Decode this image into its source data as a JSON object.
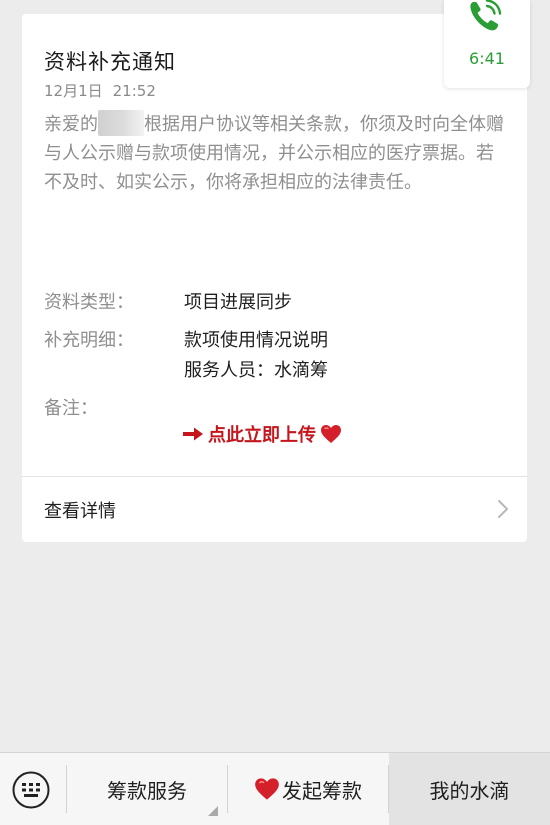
{
  "notification": {
    "title": "资料补充通知",
    "date": "12月1日",
    "time": "21:52",
    "intro_prefix": "亲爱的",
    "intro_rest": "根据用户协议等相关条款，你须及时向全体赠与人公示赠与款项使用情况，并公示相应的医疗票据。若不及时、如实公示，你将承担相应的法律责任。",
    "fields": {
      "type_label": "资料类型：",
      "type_value": "项目进展同步",
      "detail_label": "补充明细：",
      "detail_value_1": "款项使用情况说明",
      "detail_value_2": "服务人员：水滴筹",
      "remark_label": "备注："
    },
    "upload_link": "点此立即上传",
    "view_details": "查看详情"
  },
  "call_widget": {
    "duration": "6:41",
    "color": "#2a9d35"
  },
  "bottom_bar": {
    "tabs": [
      {
        "label": "筹款服务"
      },
      {
        "label": "发起筹款"
      },
      {
        "label": "我的水滴"
      }
    ]
  },
  "colors": {
    "accent_red": "#c4161c",
    "muted_text": "#8f8f8f"
  }
}
